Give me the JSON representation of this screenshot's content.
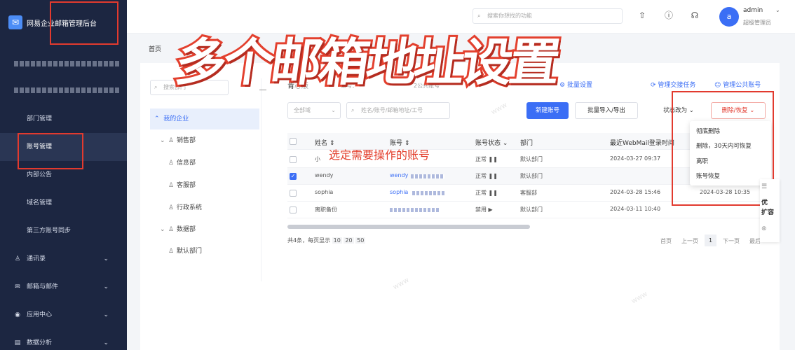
{
  "brand": {
    "title": "网易企业邮箱管理后台"
  },
  "topbar": {
    "search_placeholder": "搜索你想找的功能",
    "user_initial": "a",
    "user_name": "admin",
    "user_role": "超级管理员"
  },
  "sidebar": {
    "items": [
      {
        "label": "部门管理",
        "active": false
      },
      {
        "label": "账号管理",
        "active": true
      },
      {
        "label": "内部公告",
        "active": false
      },
      {
        "label": "域名管理",
        "active": false
      },
      {
        "label": "第三方账号同步",
        "active": false
      }
    ],
    "groups": [
      {
        "label": "通讯录",
        "icon": "contacts-icon"
      },
      {
        "label": "邮箱与邮件",
        "icon": "mail-icon"
      },
      {
        "label": "应用中心",
        "icon": "apps-icon"
      },
      {
        "label": "数据分析",
        "icon": "chart-icon"
      }
    ]
  },
  "breadcrumb": "首页",
  "overlay": {
    "title": "多个邮箱地址设置",
    "annotation": "选定需要操作的账号"
  },
  "tree": {
    "search_placeholder": "搜索部门",
    "root": "我的企业",
    "nodes": [
      {
        "label": "销售部",
        "level": 1,
        "expandable": true
      },
      {
        "label": "信息部",
        "level": 2,
        "expandable": false
      },
      {
        "label": "客服部",
        "level": 2,
        "expandable": false
      },
      {
        "label": "行政系统",
        "level": 2,
        "expandable": false
      },
      {
        "label": "数据部",
        "level": 1,
        "expandable": true
      },
      {
        "label": "默认部门",
        "level": 2,
        "expandable": false
      }
    ]
  },
  "main": {
    "title_prefix": "肯",
    "title_mid": "心版",
    "count_text": "账号：",
    "public_text": "2公共账号",
    "links": [
      "批量设置",
      "管理交接任务",
      "管理公共账号"
    ],
    "filters": {
      "domain": "全部域",
      "search_placeholder": "姓名/账号/邮箱地址/工号"
    },
    "buttons": {
      "new": "新建账号",
      "batch": "批量导入/导出",
      "status": "状态改为",
      "delete": "删除/恢复"
    }
  },
  "table": {
    "headers": [
      "姓名",
      "账号",
      "账号状态",
      "部门",
      "最近WebMail登录时间"
    ],
    "rows": [
      {
        "name": "小",
        "account": "",
        "status": "正常",
        "dept": "默认部门",
        "time": "2024-03-27 09:37",
        "checked": false
      },
      {
        "name": "wendy",
        "account": "wendy",
        "status": "正常",
        "dept": "默认部门",
        "time": "",
        "checked": true
      },
      {
        "name": "sophia",
        "account": "sophia",
        "status": "正常",
        "dept": "客服部",
        "time": "2024-03-28 15:46",
        "checked": false
      },
      {
        "name": "离职备份",
        "account": "",
        "status": "禁用",
        "dept": "默认部门",
        "time": "2024-03-11 10:40",
        "checked": false
      }
    ],
    "partial_time": "2024-03-28 10:35"
  },
  "footer": {
    "summary": "共4条，每页显示",
    "sizes": [
      "10",
      "20",
      "50"
    ]
  },
  "pager": {
    "first": "首页",
    "prev": "上一页",
    "page": "1",
    "next": "下一页",
    "last": "最后"
  },
  "dropdown": [
    "彻底删除",
    "删除，30天内可恢复",
    "离职",
    "账号恢复"
  ],
  "sidetool": {
    "line1": "优",
    "line2": "扩容"
  },
  "colors": {
    "accent": "#3b6ef5",
    "annotation_red": "#e3402e",
    "sidebar_bg": "#1c2641"
  }
}
